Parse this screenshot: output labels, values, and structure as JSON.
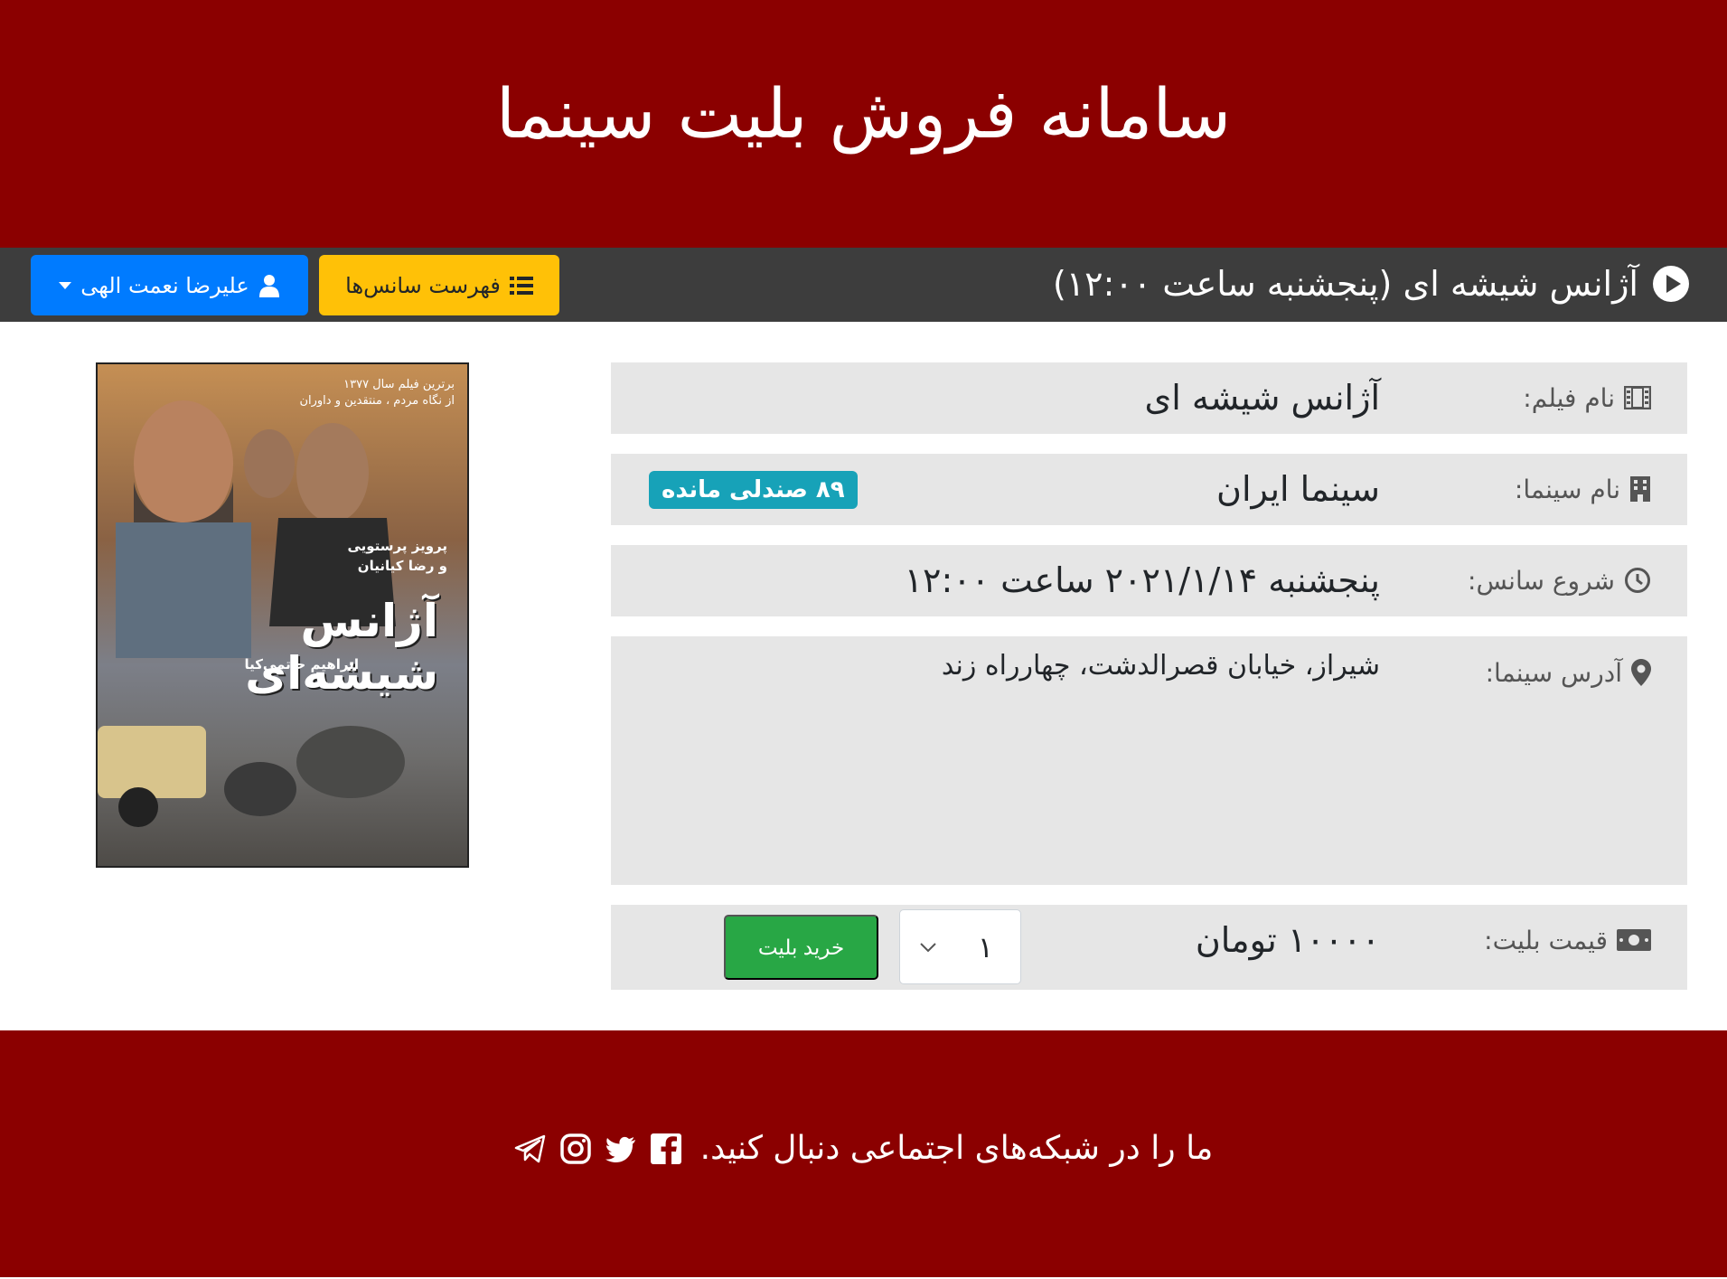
{
  "site": {
    "title": "سامانه فروش بلیت سینما"
  },
  "session_bar": {
    "title": "آژانس شیشه ای (پنجشنبه ساعت ۱۲:۰۰)",
    "sessions_button": "فهرست سانس‌ها",
    "user_button": "علیرضا نعمت الهی"
  },
  "info": {
    "film": {
      "label": "نام فیلم:",
      "value": "آژانس شیشه ای",
      "icon": "film-icon"
    },
    "cinema": {
      "label": "نام سینما:",
      "value": "سینما ایران",
      "seats_badge": "۸۹ صندلی مانده",
      "icon": "building-icon"
    },
    "start": {
      "label": "شروع سانس:",
      "value": "پنجشنبه ۲۰۲۱/۱/۱۴ ساعت ۱۲:۰۰",
      "icon": "clock-icon"
    },
    "address": {
      "label": "آدرس سینما:",
      "value": "شیراز، خیابان قصرالدشت، چهارراه زند",
      "icon": "map-marker-icon"
    },
    "price": {
      "label": "قیمت بلیت:",
      "value": "۱۰۰۰۰ تومان",
      "quantity": "۱",
      "buy_button": "خرید بلیت",
      "icon": "money-icon"
    }
  },
  "poster": {
    "top_line_1": "برترین فیلم سال ۱۳۷۷",
    "top_line_2": "از نگاه مردم ، منتقدین و داوران",
    "cast_line_1": "پرویز پرستویی",
    "cast_line_2": "و رضا کیانیان",
    "title": "آژانس شیشه‌ای",
    "director": "ابراهیم حاتمی‌کیا"
  },
  "footer": {
    "text": "ما را در شبکه‌های اجتماعی دنبال کنید."
  },
  "colors": {
    "header": "#8b0000",
    "bar": "#3d3d3d",
    "warning": "#ffc107",
    "primary": "#007bff",
    "success": "#28a745",
    "info": "#17a2b8",
    "row": "#e6e6e6"
  }
}
